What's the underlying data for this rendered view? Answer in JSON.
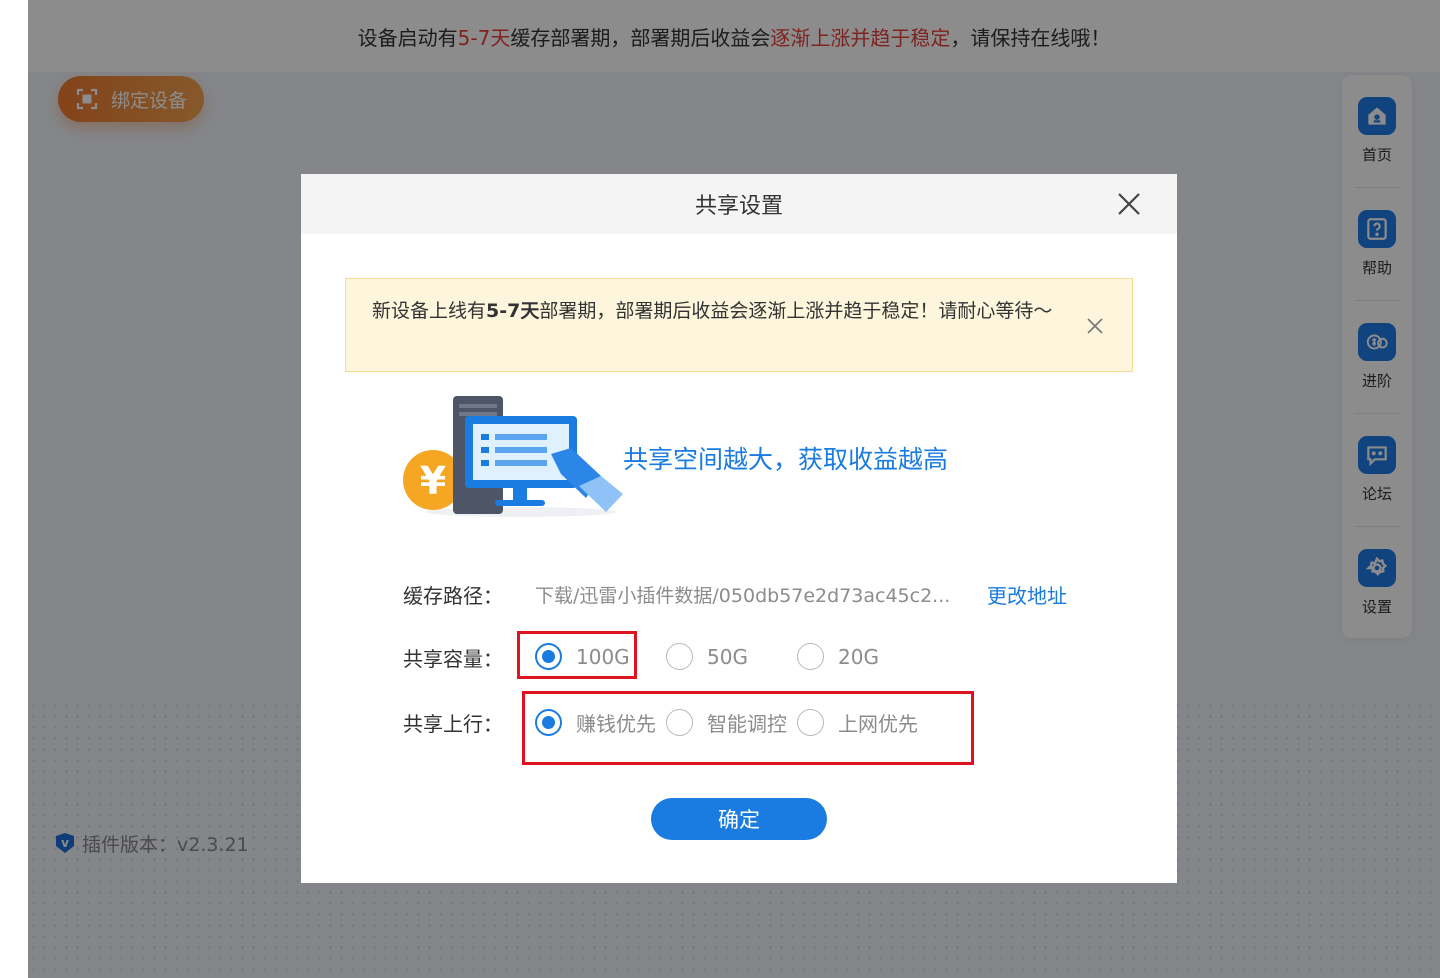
{
  "notice_bar": {
    "part1": "设备启动有",
    "highlight1": "5-7天",
    "part2": "缓存部署期，部署期后收益会",
    "highlight2": "逐渐上涨并趋于稳定",
    "part3": "，请保持在线哦！"
  },
  "bind_button": {
    "label": "绑定设备",
    "icon": "scan-frame-icon"
  },
  "version": {
    "badge": "v",
    "text": "插件版本：v2.3.21"
  },
  "side_nav": [
    {
      "label": "首页",
      "icon": "home-icon"
    },
    {
      "label": "帮助",
      "icon": "help-icon"
    },
    {
      "label": "进阶",
      "icon": "coins-icon"
    },
    {
      "label": "论坛",
      "icon": "forum-icon"
    },
    {
      "label": "设置",
      "icon": "gear-icon"
    }
  ],
  "modal": {
    "title": "共享设置",
    "tip": {
      "part1": "新设备上线有",
      "bold": "5-7天",
      "part2": "部署期，部署期后收益会逐渐上涨并趋于稳定！请耐心等待～"
    },
    "slogan": "共享空间越大，获取收益越高",
    "cache_path": {
      "label": "缓存路径：",
      "value": "下载/迅雷小插件数据/050db57e2d73ac45c2...",
      "change_link": "更改地址"
    },
    "capacity": {
      "label": "共享容量：",
      "options": [
        "100G",
        "50G",
        "20G"
      ],
      "selected": "100G"
    },
    "upload": {
      "label": "共享上行：",
      "options": [
        "赚钱优先",
        "智能调控",
        "上网优先"
      ],
      "selected": "赚钱优先"
    },
    "confirm_label": "确定"
  },
  "colors": {
    "accent": "#1a7be0",
    "highlight_red": "#e8413c",
    "annotation_red": "#e0141e",
    "bind_orange": "#f07a2f",
    "tip_bg": "#fdf6dd"
  }
}
